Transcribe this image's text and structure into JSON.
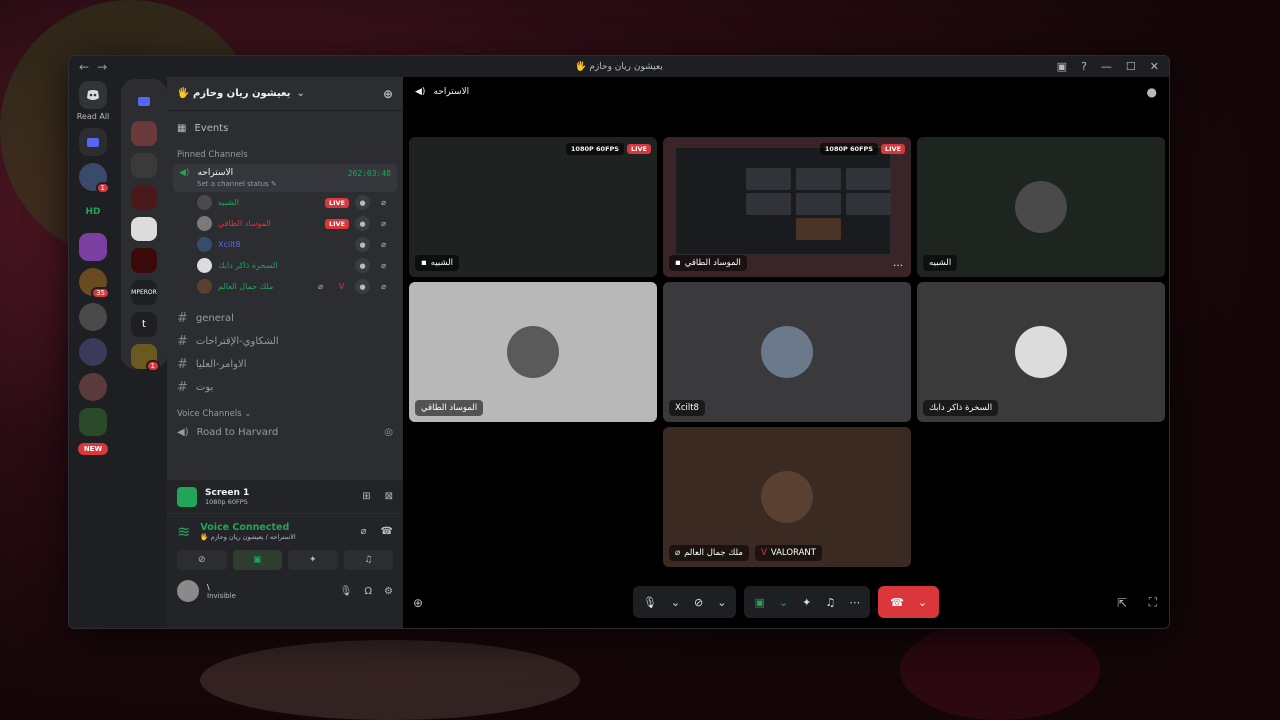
{
  "window": {
    "title": "🖐 يعيشون ريان وحازم",
    "nav_back": "←",
    "nav_fwd": "→",
    "ctrls": [
      "▣",
      "?",
      "—",
      "☐",
      "✕"
    ]
  },
  "guilds": {
    "read_all": "Read All",
    "new_badge": "NEW",
    "badges": [
      "1",
      "35",
      "1"
    ],
    "folder_labels": [
      "MPEROR",
      "t"
    ]
  },
  "server": {
    "name": "🖐 يعيشون ريان وحازم",
    "events_label": "Events",
    "pinned_label": "Pinned Channels",
    "voice_channel": {
      "name": "الاستراحه",
      "timer": "262:03:48",
      "status": "Set a channel status ✎"
    },
    "voice_users": [
      {
        "name": "الشبيه",
        "color": "#23a559",
        "live": "LIVE"
      },
      {
        "name": "الموساد الطاقي",
        "color": "#da373c",
        "live": "LIVE"
      },
      {
        "name": "Xcilt8",
        "color": "#5865f2",
        "live": ""
      },
      {
        "name": "السخرة ذاكر دابك",
        "color": "#23a559",
        "live": ""
      },
      {
        "name": "ملك جمال العالم",
        "color": "#23a559",
        "live": ""
      }
    ],
    "text_channels": [
      "general",
      "الشكاوي-الإقتراحات",
      "الاوامر-العليا",
      "بوت"
    ],
    "voice_category": "Voice Channels ⌄",
    "voice_room": "Road to Harvard"
  },
  "panel": {
    "screen_title": "Screen 1",
    "screen_sub": "1080p 60FPS",
    "vc_title": "Voice Connected",
    "vc_sub": "🖐 الاستراحه / يعيشون ريان وحازم",
    "user_name": "\\",
    "user_status": "Invisible"
  },
  "main": {
    "channel_name": "الاستراحه",
    "tiles": [
      {
        "name": "الشبيه",
        "quality": "1080P 60FPS",
        "live": "LIVE"
      },
      {
        "name": "الموساد الطاقي",
        "quality": "1080P 60FPS",
        "live": "LIVE"
      },
      {
        "name": "الشبيه"
      },
      {
        "name": "الموساد الطاقي"
      },
      {
        "name": "Xcilt8"
      },
      {
        "name": "السخرة ذاكر دابك"
      },
      {
        "name": "ملك جمال العالم",
        "game": "VALORANT"
      }
    ]
  },
  "colors": {
    "accent": "#5865f2",
    "green": "#23a559",
    "red": "#da373c"
  }
}
